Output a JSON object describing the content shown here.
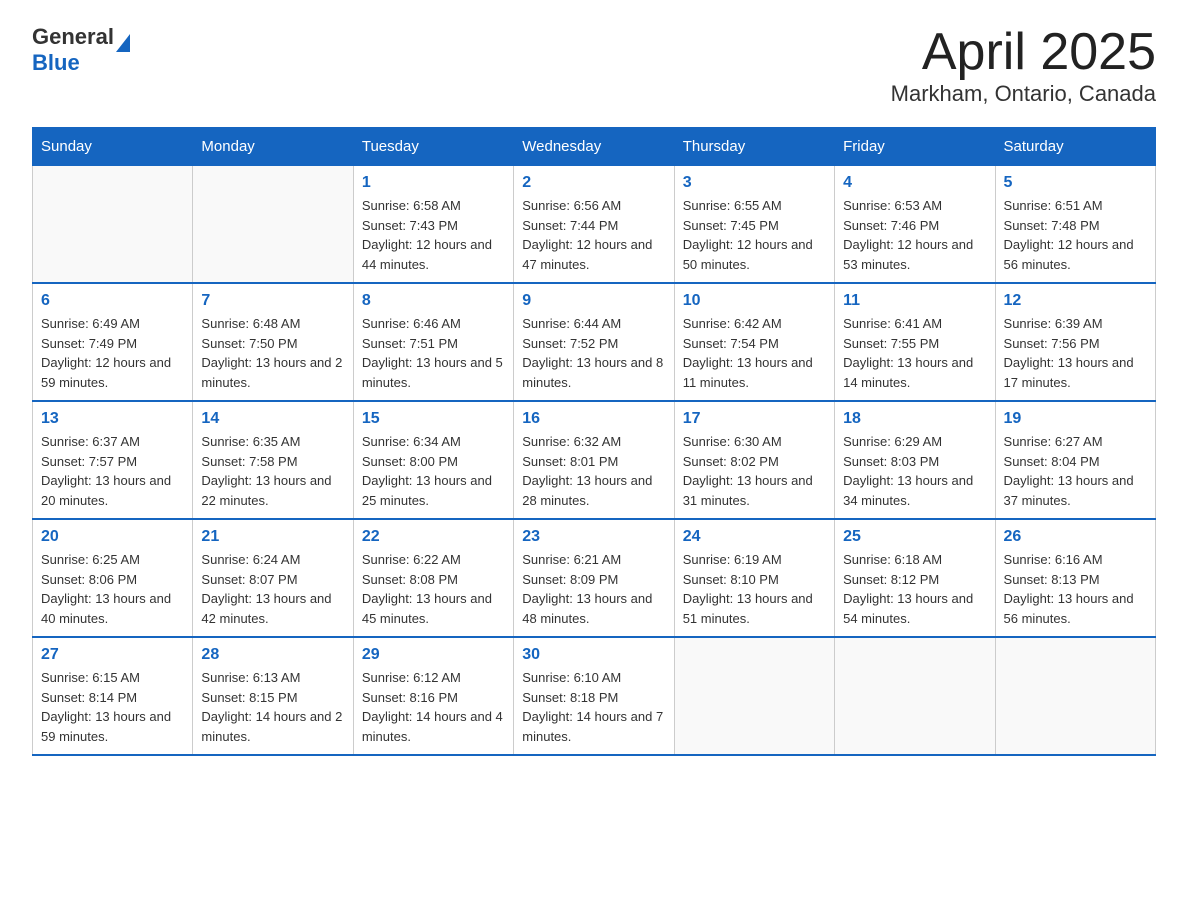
{
  "header": {
    "logo_general": "General",
    "logo_blue": "Blue",
    "title": "April 2025",
    "subtitle": "Markham, Ontario, Canada"
  },
  "days_of_week": [
    "Sunday",
    "Monday",
    "Tuesday",
    "Wednesday",
    "Thursday",
    "Friday",
    "Saturday"
  ],
  "weeks": [
    [
      {
        "day": "",
        "info": ""
      },
      {
        "day": "",
        "info": ""
      },
      {
        "day": "1",
        "info": "Sunrise: 6:58 AM\nSunset: 7:43 PM\nDaylight: 12 hours and 44 minutes."
      },
      {
        "day": "2",
        "info": "Sunrise: 6:56 AM\nSunset: 7:44 PM\nDaylight: 12 hours and 47 minutes."
      },
      {
        "day": "3",
        "info": "Sunrise: 6:55 AM\nSunset: 7:45 PM\nDaylight: 12 hours and 50 minutes."
      },
      {
        "day": "4",
        "info": "Sunrise: 6:53 AM\nSunset: 7:46 PM\nDaylight: 12 hours and 53 minutes."
      },
      {
        "day": "5",
        "info": "Sunrise: 6:51 AM\nSunset: 7:48 PM\nDaylight: 12 hours and 56 minutes."
      }
    ],
    [
      {
        "day": "6",
        "info": "Sunrise: 6:49 AM\nSunset: 7:49 PM\nDaylight: 12 hours and 59 minutes."
      },
      {
        "day": "7",
        "info": "Sunrise: 6:48 AM\nSunset: 7:50 PM\nDaylight: 13 hours and 2 minutes."
      },
      {
        "day": "8",
        "info": "Sunrise: 6:46 AM\nSunset: 7:51 PM\nDaylight: 13 hours and 5 minutes."
      },
      {
        "day": "9",
        "info": "Sunrise: 6:44 AM\nSunset: 7:52 PM\nDaylight: 13 hours and 8 minutes."
      },
      {
        "day": "10",
        "info": "Sunrise: 6:42 AM\nSunset: 7:54 PM\nDaylight: 13 hours and 11 minutes."
      },
      {
        "day": "11",
        "info": "Sunrise: 6:41 AM\nSunset: 7:55 PM\nDaylight: 13 hours and 14 minutes."
      },
      {
        "day": "12",
        "info": "Sunrise: 6:39 AM\nSunset: 7:56 PM\nDaylight: 13 hours and 17 minutes."
      }
    ],
    [
      {
        "day": "13",
        "info": "Sunrise: 6:37 AM\nSunset: 7:57 PM\nDaylight: 13 hours and 20 minutes."
      },
      {
        "day": "14",
        "info": "Sunrise: 6:35 AM\nSunset: 7:58 PM\nDaylight: 13 hours and 22 minutes."
      },
      {
        "day": "15",
        "info": "Sunrise: 6:34 AM\nSunset: 8:00 PM\nDaylight: 13 hours and 25 minutes."
      },
      {
        "day": "16",
        "info": "Sunrise: 6:32 AM\nSunset: 8:01 PM\nDaylight: 13 hours and 28 minutes."
      },
      {
        "day": "17",
        "info": "Sunrise: 6:30 AM\nSunset: 8:02 PM\nDaylight: 13 hours and 31 minutes."
      },
      {
        "day": "18",
        "info": "Sunrise: 6:29 AM\nSunset: 8:03 PM\nDaylight: 13 hours and 34 minutes."
      },
      {
        "day": "19",
        "info": "Sunrise: 6:27 AM\nSunset: 8:04 PM\nDaylight: 13 hours and 37 minutes."
      }
    ],
    [
      {
        "day": "20",
        "info": "Sunrise: 6:25 AM\nSunset: 8:06 PM\nDaylight: 13 hours and 40 minutes."
      },
      {
        "day": "21",
        "info": "Sunrise: 6:24 AM\nSunset: 8:07 PM\nDaylight: 13 hours and 42 minutes."
      },
      {
        "day": "22",
        "info": "Sunrise: 6:22 AM\nSunset: 8:08 PM\nDaylight: 13 hours and 45 minutes."
      },
      {
        "day": "23",
        "info": "Sunrise: 6:21 AM\nSunset: 8:09 PM\nDaylight: 13 hours and 48 minutes."
      },
      {
        "day": "24",
        "info": "Sunrise: 6:19 AM\nSunset: 8:10 PM\nDaylight: 13 hours and 51 minutes."
      },
      {
        "day": "25",
        "info": "Sunrise: 6:18 AM\nSunset: 8:12 PM\nDaylight: 13 hours and 54 minutes."
      },
      {
        "day": "26",
        "info": "Sunrise: 6:16 AM\nSunset: 8:13 PM\nDaylight: 13 hours and 56 minutes."
      }
    ],
    [
      {
        "day": "27",
        "info": "Sunrise: 6:15 AM\nSunset: 8:14 PM\nDaylight: 13 hours and 59 minutes."
      },
      {
        "day": "28",
        "info": "Sunrise: 6:13 AM\nSunset: 8:15 PM\nDaylight: 14 hours and 2 minutes."
      },
      {
        "day": "29",
        "info": "Sunrise: 6:12 AM\nSunset: 8:16 PM\nDaylight: 14 hours and 4 minutes."
      },
      {
        "day": "30",
        "info": "Sunrise: 6:10 AM\nSunset: 8:18 PM\nDaylight: 14 hours and 7 minutes."
      },
      {
        "day": "",
        "info": ""
      },
      {
        "day": "",
        "info": ""
      },
      {
        "day": "",
        "info": ""
      }
    ]
  ]
}
